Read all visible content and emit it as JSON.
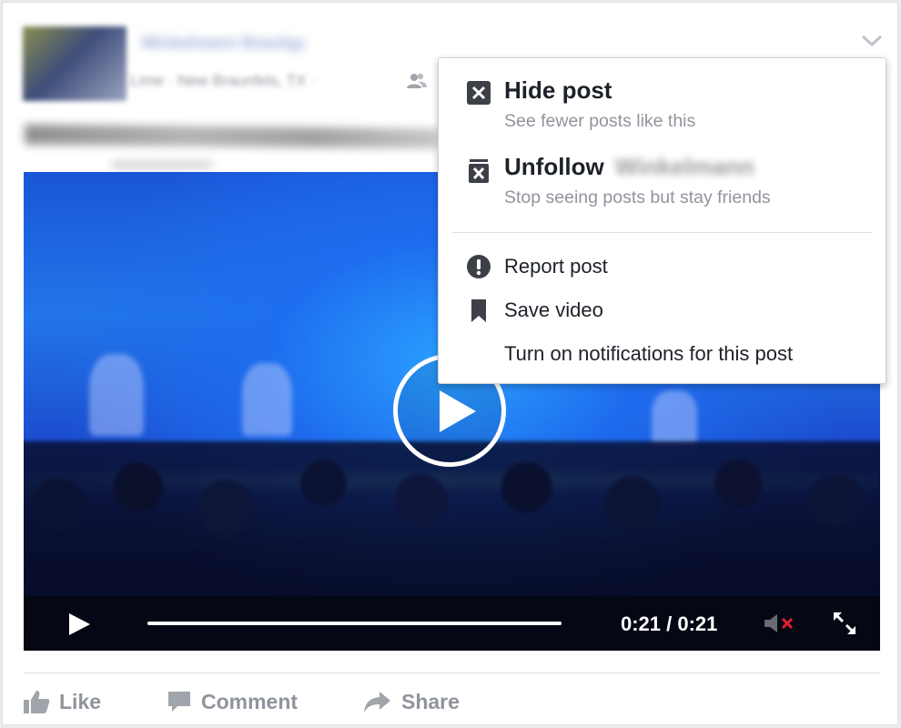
{
  "post": {
    "author_name": "Winkelmann Brautigam",
    "meta": "Lime · New Braunfels, TX ·",
    "audience_icon": "friends-icon",
    "options_icon": "chevron-down-icon"
  },
  "video": {
    "current_time": "0:21",
    "duration": "0:21",
    "time_display": "0:21 / 0:21",
    "progress": 1.0,
    "muted": true,
    "icons": {
      "play": "play-icon",
      "mute": "speaker-muted-icon",
      "fullscreen": "fullscreen-icon"
    }
  },
  "actions": [
    {
      "label": "Like",
      "icon": "thumbs-up-icon"
    },
    {
      "label": "Comment",
      "icon": "comment-icon"
    },
    {
      "label": "Share",
      "icon": "share-arrow-icon"
    }
  ],
  "menu": {
    "hide": {
      "title": "Hide post",
      "subtitle": "See fewer posts like this",
      "icon": "hide-x-icon"
    },
    "unfollow": {
      "title": "Unfollow",
      "name": "Winkelmann",
      "subtitle": "Stop seeing posts but stay friends",
      "icon": "unfollow-icon"
    },
    "report": {
      "label": "Report post",
      "icon": "exclamation-icon"
    },
    "save": {
      "label": "Save video",
      "icon": "bookmark-icon"
    },
    "notifications": {
      "label": "Turn on notifications for this post"
    }
  },
  "colors": {
    "text_primary": "#1d2129",
    "text_secondary": "#90949c",
    "link_blue": "#4267b2",
    "mute_red": "#e0202a"
  }
}
